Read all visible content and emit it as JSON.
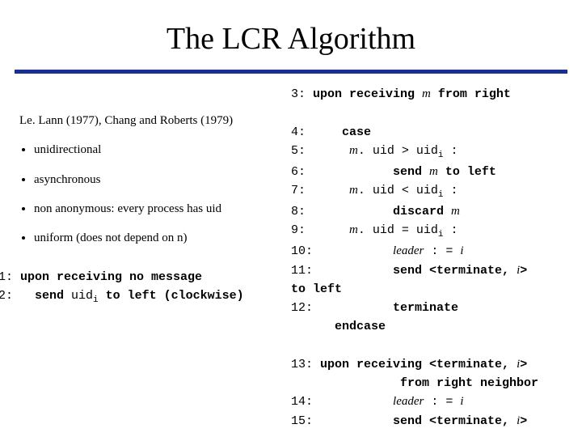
{
  "title": "The LCR Algorithm",
  "ref": "Le. Lann (1977), Chang and Roberts (1979)",
  "bullets": [
    "unidirectional",
    "asynchronous",
    "non anonymous: every process has uid",
    "uniform (does not depend on n)"
  ],
  "codeLeft": {
    "l1_lineno": "1:",
    "l1a": " upon receiving no message",
    "l2_lineno": "2:",
    "l2a": "   send ",
    "l2b": "uid",
    "l2c": " to left (clockwise)"
  },
  "codeRight": {
    "l3_lineno": "3:",
    "l3a": " upon receiving ",
    "l3m": "m",
    "l3b": " from right",
    "l4_lineno": "4:",
    "l4a": "     case",
    "l5_lineno": "5:",
    "l5a": "      ",
    "l5m": "m",
    "l5b": ". uid > uid",
    "l5c": " :",
    "l6_lineno": "6:",
    "l6a": "            send ",
    "l6m": "m",
    "l6b": " to left",
    "l7_lineno": "7:",
    "l7a": "      ",
    "l7m": "m",
    "l7b": ". uid < uid",
    "l7c": " :",
    "l8_lineno": "8:",
    "l8a": "            discard ",
    "l8m": "m",
    "l9_lineno": "9:",
    "l9a": "      ",
    "l9m": "m",
    "l9b": ". uid = uid",
    "l9c": " :",
    "l10_lineno": "10:",
    "l10a": "           ",
    "l10b": "leader",
    "l10c": " : = ",
    "l10d": "i",
    "l11_lineno": "11:",
    "l11a": "           send <terminate, ",
    "l11b": "i",
    "l11c": ">",
    "l11_toleft": "to left",
    "l12_lineno": "12:",
    "l12a": "           terminate",
    "l12_end": "      endcase",
    "l13_lineno": "13:",
    "l13a": " upon receiving <terminate, ",
    "l13b": "i",
    "l13c": ">",
    "l13_from": "               from right neighbor",
    "l14_lineno": "14:",
    "l14a": "           ",
    "l14b": "leader",
    "l14c": " : = ",
    "l14d": "i",
    "l15_lineno": "15:",
    "l15a": "           send <terminate, ",
    "l15b": "i",
    "l15c": ">"
  }
}
